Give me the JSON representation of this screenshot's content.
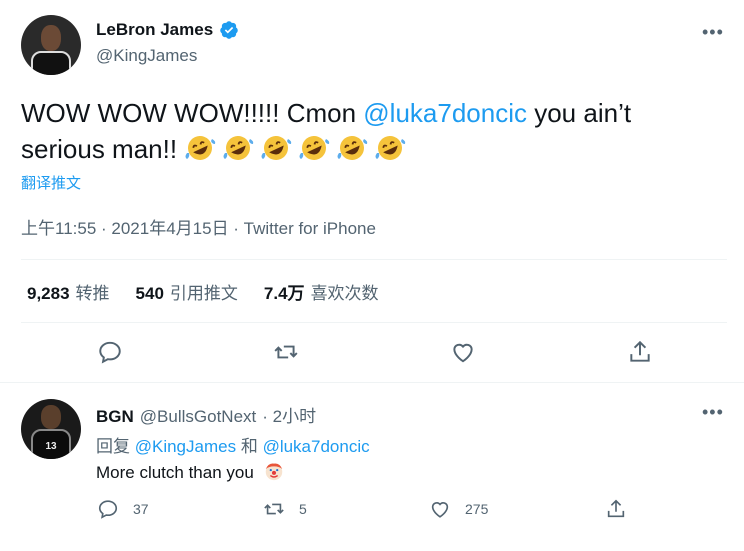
{
  "main_tweet": {
    "display_name": "LeBron James",
    "handle": "@KingJames",
    "more_label": "•••",
    "text_part1": "WOW WOW WOW!!!!! Cmon ",
    "mention": "@luka7doncic",
    "text_part2": " you ain’t serious man!! ",
    "emoji_name": "rolling-on-floor-laughing-icon",
    "emoji_count": 6,
    "translate_label": "翻译推文",
    "meta": "上午11:55 · 2021年4月15日 · Twitter for iPhone",
    "stats": [
      {
        "value": "9,283",
        "label": "转推"
      },
      {
        "value": "540",
        "label": "引用推文"
      },
      {
        "value": "7.4万",
        "label": "喜欢次数"
      }
    ],
    "actions": [
      "reply-icon",
      "retweet-icon",
      "like-icon",
      "share-icon"
    ]
  },
  "reply_tweet": {
    "display_name": "BGN",
    "handle": "@BullsGotNext",
    "time": "· 2小时",
    "more_label": "•••",
    "reply_prefix": "回复",
    "reply_mention1": "@KingJames",
    "reply_and": "和",
    "reply_mention2": "@luka7doncic",
    "text": "More clutch than you",
    "emoji_name": "clown-face-icon",
    "jersey_number": "13",
    "counts": {
      "reply": "37",
      "retweet": "5",
      "like": "275"
    }
  },
  "colors": {
    "accent": "#1d9bf0",
    "text": "#0f1419",
    "secondary": "#536471",
    "divider": "#eff3f4"
  }
}
